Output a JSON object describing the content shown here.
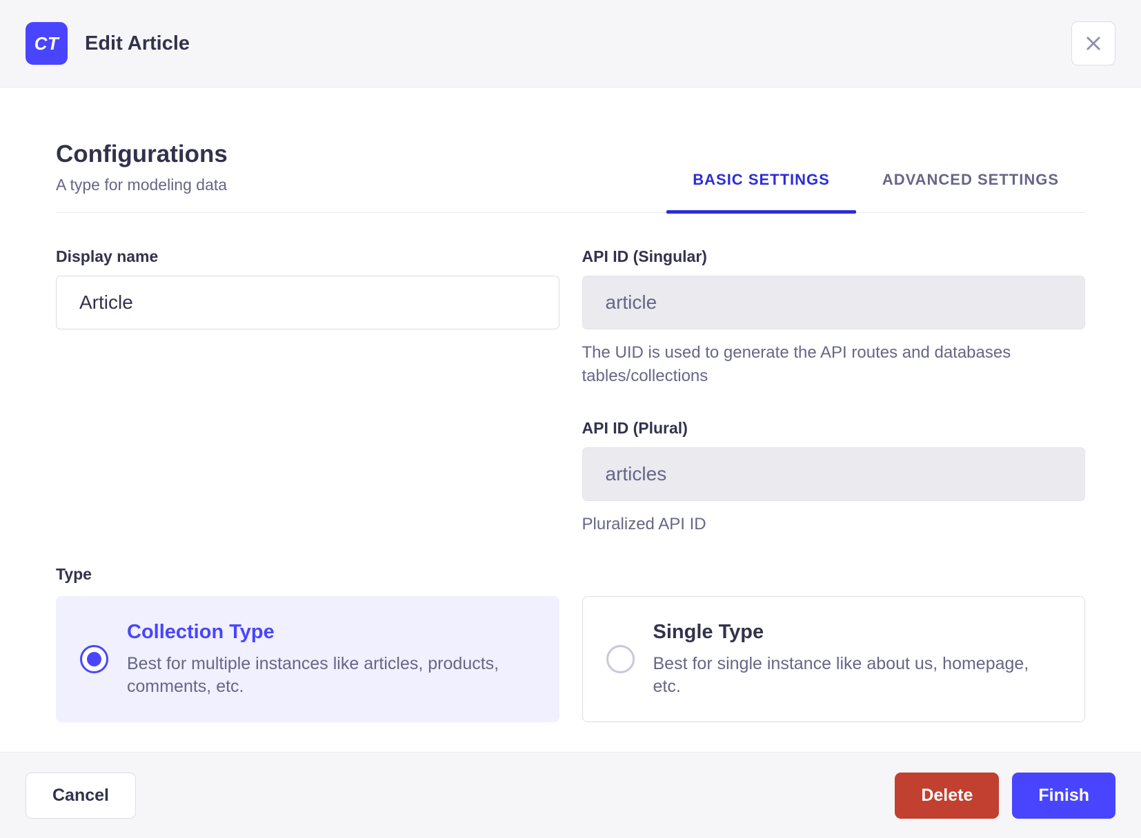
{
  "modal": {
    "badge": "CT",
    "title": "Edit Article"
  },
  "configurations": {
    "title": "Configurations",
    "subtitle": "A type for modeling data"
  },
  "tabs": [
    {
      "label": "BASIC SETTINGS",
      "active": true
    },
    {
      "label": "ADVANCED SETTINGS",
      "active": false
    }
  ],
  "form": {
    "display_name": {
      "label": "Display name",
      "value": "Article"
    },
    "api_id_singular": {
      "label": "API ID (Singular)",
      "value": "article",
      "hint": "The UID is used to generate the API routes and databases tables/collections"
    },
    "api_id_plural": {
      "label": "API ID (Plural)",
      "value": "articles",
      "hint": "Pluralized API ID"
    },
    "type": {
      "label": "Type",
      "options": [
        {
          "title": "Collection Type",
          "description": "Best for multiple instances like articles, products, comments, etc.",
          "selected": true
        },
        {
          "title": "Single Type",
          "description": "Best for single instance like about us, homepage, etc.",
          "selected": false
        }
      ]
    }
  },
  "footer": {
    "cancel_label": "Cancel",
    "delete_label": "Delete",
    "finish_label": "Finish"
  },
  "colors": {
    "primary": "#4945FF",
    "tab_active_blue": "#2C2CDA",
    "danger_red": "#C2402F",
    "selected_card_bg": "#F0F0FF",
    "bar_bg": "#F6F6F9",
    "text_dark": "#32324D",
    "text_muted": "#666687"
  }
}
